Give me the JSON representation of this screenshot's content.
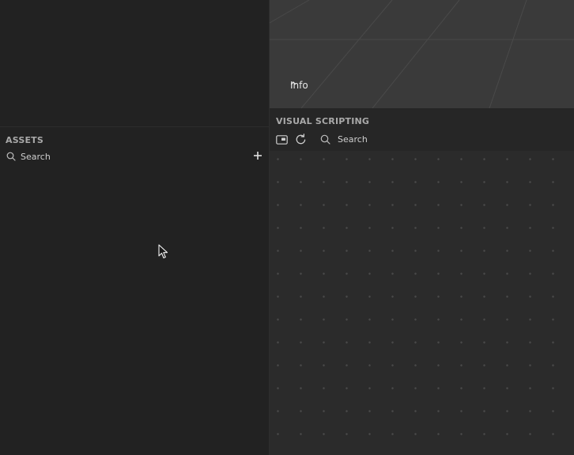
{
  "viewport": {
    "info_label": "Info",
    "chevron_icon": "chevron-up-icon"
  },
  "assets": {
    "title": "ASSETS",
    "search_placeholder": "Search",
    "search_icon": "search-icon",
    "add_icon": "plus-icon"
  },
  "visual_scripting": {
    "title": "VISUAL SCRIPTING",
    "toolbar": {
      "preview_icon": "picture-in-picture-icon",
      "refresh_icon": "refresh-icon",
      "search_icon": "search-icon",
      "search_placeholder": "Search"
    }
  },
  "colors": {
    "panel_bg": "#222222",
    "viewport_bg": "#3a3a3a",
    "canvas_bg": "#2b2b2b",
    "grid_dot": "#4a4a4a",
    "label_muted": "#a9a9a9"
  }
}
